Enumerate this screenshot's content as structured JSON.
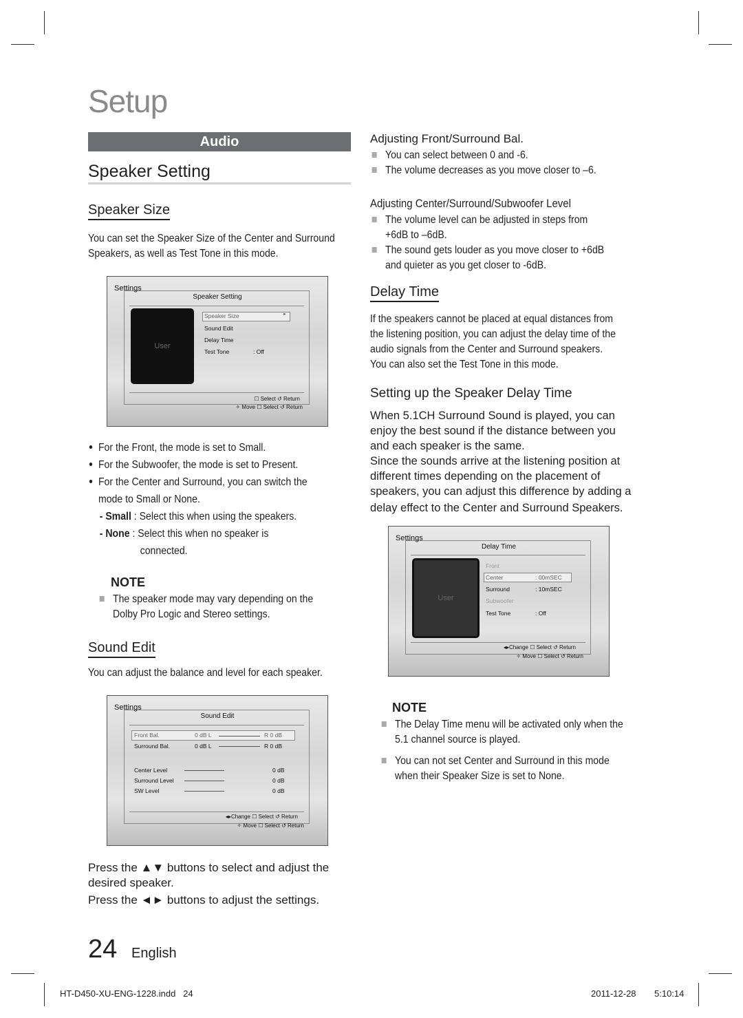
{
  "page": {
    "title": "Setup",
    "section_bar": "Audio",
    "page_number": "24",
    "language": "English",
    "footer_file": "HT-D450-XU-ENG-1228.indd   24",
    "footer_date": "2011-12-28",
    "footer_time": "5:10:14"
  },
  "left": {
    "heading": "Speaker Setting",
    "speaker_size": {
      "heading": "Speaker Size",
      "intro": [
        "You can set the Speaker Size of the Center and Surround",
        "Speakers, as well as Test Tone in this mode."
      ],
      "bullets": [
        "For the Front, the mode is set to Small.",
        "For the Subwoofer, the mode is set to Present.",
        "For the Center and Surround, you can switch the",
        "mode to Small or None."
      ],
      "small_label": "- Small",
      "small_text": ":  Select this when using the speakers.",
      "none_label": "- None",
      "none_text": ": Select this when no speaker is",
      "none_text2": "connected.",
      "note_title": "NOTE",
      "note": [
        "The speaker mode may vary depending on the",
        "Dolby Pro Logic and Stereo settings."
      ]
    },
    "sound_edit": {
      "heading": "Sound Edit",
      "intro": "You can adjust the balance and level for each speaker.",
      "press1": "Press the ▲▼ buttons to select and adjust the",
      "press1b": "desired speaker.",
      "press2": "Press the ◄► buttons to adjust the settings."
    }
  },
  "menu1": {
    "settings": "Settings",
    "title": "Speaker Setting",
    "user": "User",
    "items": [
      "Speaker Size",
      "Sound Edit",
      "Delay Time",
      "Test Tone"
    ],
    "arrow": "►",
    "test_tone_value": ":   Off",
    "foot1": "☐ Select   ↺ Return",
    "foot2": "✧ Move   ☐ Select   ↺ Return"
  },
  "menu2": {
    "settings": "Settings",
    "title": "Sound Edit",
    "bal": [
      {
        "label": "Front Bal.",
        "l": "0 dB  L",
        "r": "R  0 dB"
      },
      {
        "label": "Surround Bal.",
        "l": "0 dB  L",
        "r": "R  0 dB"
      }
    ],
    "levels": [
      {
        "label": "Center Level",
        "value": "0 dB"
      },
      {
        "label": "Surround Level",
        "value": "0 dB"
      },
      {
        "label": "SW Level",
        "value": "0 dB"
      }
    ],
    "foot1": "◂▸Change ☐ Select   ↺ Return",
    "foot2": "✧ Move   ☐ Select   ↺ Return"
  },
  "menu3": {
    "settings": "Settings",
    "title": "Delay Time",
    "user": "User",
    "items": [
      {
        "label": "Front",
        "value": ""
      },
      {
        "label": "Center",
        "value": ":   00mSEC"
      },
      {
        "label": "Surround",
        "value": ":   10mSEC"
      },
      {
        "label": "Subwoofer",
        "value": ""
      },
      {
        "label": "Test Tone",
        "value": ":   Off"
      }
    ],
    "foot1": "◂▸Change ☐ Select   ↺ Return",
    "foot2": "✧ Move   ☐ Select   ↺ Return"
  },
  "right": {
    "bal": {
      "heading": "Adjusting Front/Surround Bal.",
      "items": [
        "You can select between 0 and -6.",
        "The volume decreases as you move closer to –6."
      ]
    },
    "level": {
      "heading": "Adjusting Center/Surround/Subwoofer Level",
      "items": [
        [
          "The volume level can be adjusted in steps from",
          "+6dB to –6dB."
        ],
        [
          "The sound gets louder as you move closer to +6dB",
          "and quieter as you get closer to -6dB."
        ]
      ]
    },
    "delay": {
      "heading": "Delay Time",
      "intro": [
        "If the speakers cannot be placed at equal distances from",
        "the listening position, you can adjust the delay time of the",
        "audio signals from the Center and  Surround speakers.",
        "You can also set the Test Tone in this mode."
      ]
    },
    "setup_delay": {
      "heading": "Setting up the Speaker Delay Time",
      "text": [
        "When 5.1CH Surround Sound is played, you can",
        "enjoy the best sound if the distance between you",
        "and each speaker is the same.",
        "Since the sounds arrive at the listening position at",
        "different times depending on the placement of",
        "speakers, you can adjust this difference by adding a",
        "delay effect to the Center and Surround Speakers."
      ]
    },
    "note_title": "NOTE",
    "notes": [
      [
        "The Delay Time menu will be activated only when the",
        "5.1 channel source is played."
      ],
      [
        "You can not set Center and Surround in this mode",
        "when their Speaker Size is set to None."
      ]
    ]
  }
}
